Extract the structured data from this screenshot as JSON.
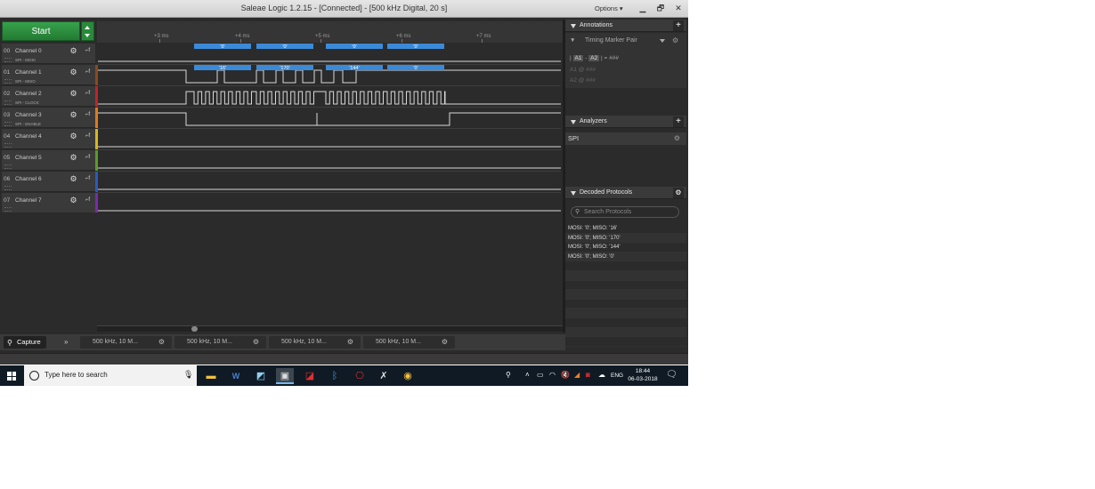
{
  "window": {
    "title": "Saleae Logic 1.2.15 - [Connected] - [500 kHz Digital, 20 s]",
    "options_label": "Options ▾",
    "min": "▁",
    "max": "🗗",
    "close": "✕"
  },
  "start_label": "Start",
  "timebar": {
    "ticks": [
      "+3 ms",
      "+4 ms",
      "+5 ms",
      "+6 ms",
      "+7 ms"
    ]
  },
  "channels": [
    {
      "num": "00",
      "name": "Channel 0",
      "sub": "SPI - MOSI",
      "color": "#2b2b2b"
    },
    {
      "num": "01",
      "name": "Channel 1",
      "sub": "SPI - MISO",
      "color": "#8a4a1f"
    },
    {
      "num": "02",
      "name": "Channel 2",
      "sub": "SPI - CLOCK",
      "color": "#c0242a"
    },
    {
      "num": "03",
      "name": "Channel 3",
      "sub": "SPI - ENABLE",
      "color": "#e07a1a"
    },
    {
      "num": "04",
      "name": "Channel 4",
      "sub": "",
      "color": "#d8b61a"
    },
    {
      "num": "05",
      "name": "Channel 5",
      "sub": "",
      "color": "#5a9a2a"
    },
    {
      "num": "06",
      "name": "Channel 6",
      "sub": "",
      "color": "#2a5ac0"
    },
    {
      "num": "07",
      "name": "Channel 7",
      "sub": "",
      "color": "#7a2ab0"
    }
  ],
  "mosi_labels": [
    "'0'",
    "'0'",
    "'0'",
    "'0'"
  ],
  "miso_labels": [
    "'16'",
    "'170'",
    "'144'",
    "'0'"
  ],
  "bottom": {
    "capture_label": "Capture",
    "chevrons": "»",
    "tabs": [
      "500 kHz, 10 M...",
      "500 kHz, 10 M...",
      "500 kHz, 10 M...",
      "500 kHz, 10 M..."
    ]
  },
  "annotations": {
    "header": "Annotations",
    "add": "+",
    "selector": "Timing Marker Pair",
    "formula": [
      "|",
      "A1",
      "-",
      "A2",
      "| = ###"
    ],
    "a1": "A1  @  ###",
    "a2": "A2  @  ###"
  },
  "analyzers": {
    "header": "Analyzers",
    "add": "+",
    "items": [
      "SPI"
    ]
  },
  "decoded": {
    "header": "Decoded Protocols",
    "search_placeholder": "Search Protocols",
    "rows": [
      "MOSI: '0';  MISO: '16'",
      "MOSI: '0';  MISO: '170'",
      "MOSI: '0';  MISO: '144'",
      "MOSI: '0';  MISO: '0'"
    ]
  },
  "taskbar": {
    "search_text": "Type here to search",
    "lang": "ENG",
    "time": "18:44",
    "date": "06-03-2018"
  }
}
